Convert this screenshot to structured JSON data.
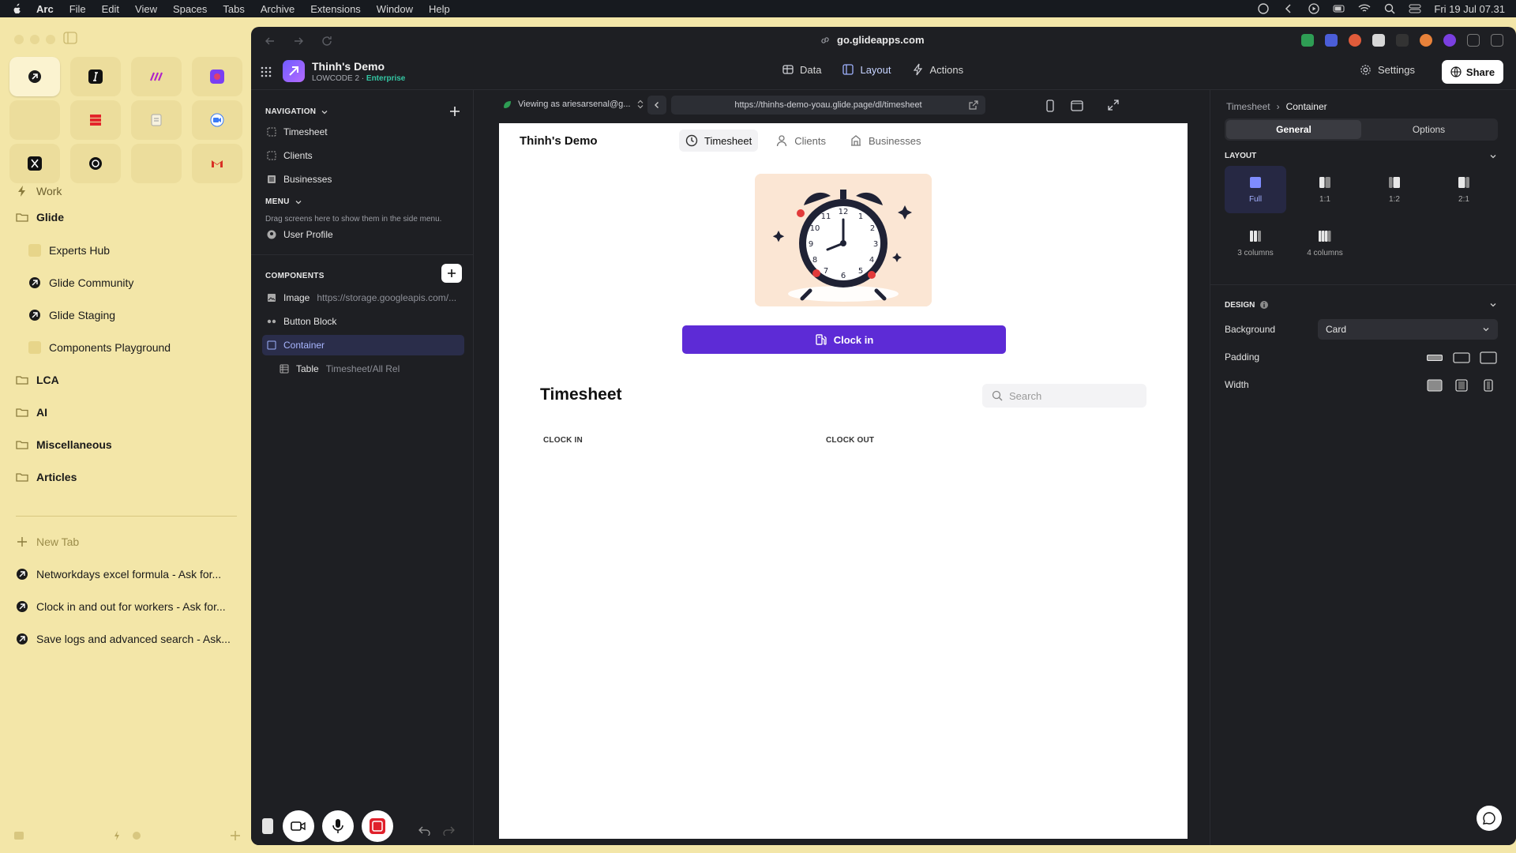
{
  "menubar": {
    "app": "Arc",
    "items": [
      "File",
      "Edit",
      "View",
      "Spaces",
      "Tabs",
      "Archive",
      "Extensions",
      "Window",
      "Help"
    ],
    "datetime": "Fri 19 Jul  07.31"
  },
  "arc": {
    "spaces": [
      {
        "label": "Work",
        "icon": "lightning-icon"
      },
      {
        "label": "Glide",
        "icon": "folder-icon"
      },
      {
        "label": "Experts Hub",
        "icon": "page-icon"
      },
      {
        "label": "Glide Community",
        "icon": "glide-icon"
      },
      {
        "label": "Glide Staging",
        "icon": "glide-icon"
      },
      {
        "label": "Components Playground",
        "icon": "page-icon"
      },
      {
        "label": "LCA",
        "icon": "folder-icon"
      },
      {
        "label": "AI",
        "icon": "folder-icon"
      },
      {
        "label": "Miscellaneous",
        "icon": "folder-icon"
      },
      {
        "label": "Articles",
        "icon": "folder-icon"
      }
    ],
    "new_tab": "New Tab",
    "tabs": [
      "Networkdays excel formula - Ask for...",
      "Clock in and out for workers - Ask for...",
      "Save logs and advanced search - Ask..."
    ]
  },
  "browser": {
    "domain": "go.glideapps.com"
  },
  "glide": {
    "app_title": "Thinh's Demo",
    "plan": "LOWCODE 2",
    "tier": "Enterprise",
    "tabs": [
      "Data",
      "Layout",
      "Actions"
    ],
    "active_tab": "Layout",
    "settings": "Settings",
    "share": "Share"
  },
  "left_panel": {
    "navigation_head": "NAVIGATION",
    "nav_items": [
      "Timesheet",
      "Clients",
      "Businesses"
    ],
    "menu_head": "MENU",
    "menu_hint": "Drag screens here to show them in the side menu.",
    "menu_items": [
      "User Profile"
    ],
    "components_head": "COMPONENTS",
    "components": [
      {
        "label": "Image",
        "detail": "https://storage.googleapis.com/..."
      },
      {
        "label": "Button Block",
        "detail": ""
      },
      {
        "label": "Container",
        "detail": ""
      },
      {
        "label": "Table",
        "detail": "Timesheet/All Rel"
      }
    ],
    "selected_component": "Container"
  },
  "preview_toolbar": {
    "viewing": "Viewing as ariesarsenal@g...",
    "url": "https://thinhs-demo-yoau.glide.page/dl/timesheet"
  },
  "preview": {
    "app_title": "Thinh's Demo",
    "tabs": [
      "Timesheet",
      "Clients",
      "Businesses"
    ],
    "active_tab": "Timesheet",
    "button": "Clock in",
    "section_title": "Timesheet",
    "search_placeholder": "Search",
    "columns": [
      "CLOCK IN",
      "CLOCK OUT"
    ]
  },
  "right_panel": {
    "breadcrumb": [
      "Timesheet",
      "Container"
    ],
    "tabs": [
      "General",
      "Options"
    ],
    "active_tab": "General",
    "layout_head": "LAYOUT",
    "layouts": [
      "Full",
      "1:1",
      "1:2",
      "2:1",
      "3 columns",
      "4 columns"
    ],
    "selected_layout": "Full",
    "design_head": "DESIGN",
    "background_label": "Background",
    "background_value": "Card",
    "padding_label": "Padding",
    "width_label": "Width"
  },
  "colors": {
    "arc_bg": "#f3e6a8",
    "panel_bg": "#1e1f23",
    "accent": "#5d2bd6",
    "enterprise": "#34c6a3"
  }
}
